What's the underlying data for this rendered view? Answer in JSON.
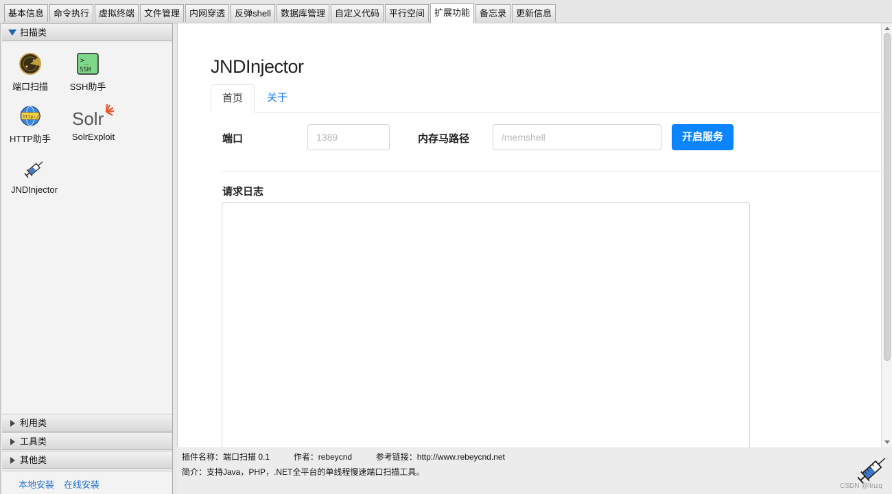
{
  "tabs": [
    "基本信息",
    "命令执行",
    "虚拟终端",
    "文件管理",
    "内网穿透",
    "反弹shell",
    "数据库管理",
    "自定义代码",
    "平行空间",
    "扩展功能",
    "备忘录",
    "更新信息"
  ],
  "active_tab": "扩展功能",
  "sidebar": {
    "expanded_category": "扫描类",
    "plugins": [
      {
        "label": "端口扫描",
        "icon": "radar-icon"
      },
      {
        "label": "SSH助手",
        "icon": "ssh-terminal-icon"
      },
      {
        "label": "HTTP助手",
        "icon": "http-globe-icon"
      },
      {
        "label": "SolrExploit",
        "icon": "solr-logo-icon"
      },
      {
        "label": "JNDInjector",
        "icon": "syringe-icon"
      }
    ],
    "collapsed_categories": [
      "利用类",
      "工具类",
      "其他类"
    ],
    "install_local": "本地安装",
    "install_online": "在线安装"
  },
  "panel": {
    "title": "JNDInjector",
    "nav_tabs": [
      "首页",
      "关于"
    ],
    "port_label": "端口",
    "port_placeholder": "1389",
    "memshell_label": "内存马路径",
    "memshell_placeholder": "/memshell",
    "start_button": "开启服务",
    "log_label": "请求日志",
    "log_value": ""
  },
  "info": {
    "plugin_name": "插件名称：端口扫描 0.1",
    "author": "作者：rebeycnd",
    "link": "参考链接：http://www.rebeycnd.net",
    "description": "简介：支持Java，PHP，.NET全平台的单线程慢速端口扫描工具。"
  },
  "watermark": "CSDN @linzq",
  "colors": {
    "accent": "#0a84ff",
    "link": "#1d6fd0"
  }
}
